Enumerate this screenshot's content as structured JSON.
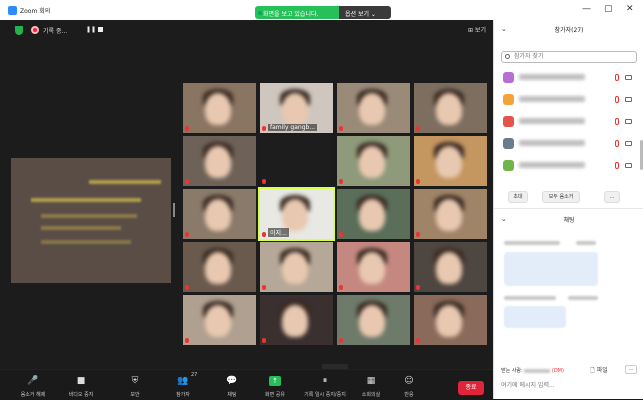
{
  "window": {
    "title": "Zoom 회의",
    "share_status": "화면을 보고 있습니다.",
    "view_options": "옵션 보기 ⌄",
    "controls": [
      "—",
      "▢",
      "✕"
    ]
  },
  "meeting": {
    "recording_label": "기록 중...",
    "view_label": "⊞ 보기"
  },
  "tiles": [
    {
      "name": "",
      "bg": "#8a7462"
    },
    {
      "name": "family gangb...",
      "bg": "#cfc7bf"
    },
    {
      "name": "",
      "bg": "#9a8a78"
    },
    {
      "name": "",
      "bg": "#7d6e60"
    },
    {
      "name": "",
      "bg": "#6e6258"
    },
    {
      "name": "",
      "bg": "#1d1d1d"
    },
    {
      "name": "",
      "bg": "#8e9a7a"
    },
    {
      "name": "",
      "bg": "#c49660"
    },
    {
      "name": "",
      "bg": "#8a7a6a"
    },
    {
      "name": "이지...",
      "bg": "#e8e8e4"
    },
    {
      "name": "",
      "bg": "#5a6e5a"
    },
    {
      "name": "",
      "bg": "#a08468"
    },
    {
      "name": "",
      "bg": "#6a5a4e"
    },
    {
      "name": "",
      "bg": "#b6a898"
    },
    {
      "name": "",
      "bg": "#c48880"
    },
    {
      "name": "",
      "bg": "#4e4640"
    },
    {
      "name": "",
      "bg": "#b0a090"
    },
    {
      "name": "",
      "bg": "#3a3030"
    },
    {
      "name": "",
      "bg": "#6e7a6a"
    },
    {
      "name": "",
      "bg": "#8a6a5a"
    }
  ],
  "toolbar": {
    "items": [
      {
        "icon": "🎤",
        "label": "음소거 해제"
      },
      {
        "icon": "■",
        "label": "비디오 중지"
      },
      {
        "icon": "⛨",
        "label": "보안"
      },
      {
        "icon": "👥",
        "label": "참가자",
        "count": "27"
      },
      {
        "icon": "💬",
        "label": "채팅"
      },
      {
        "icon": "↑",
        "label": "화면 공유"
      },
      {
        "icon": "⏸",
        "label": "기록 일시 중지/중지"
      },
      {
        "icon": "▦",
        "label": "소회의실"
      },
      {
        "icon": "☺",
        "label": "반응"
      }
    ],
    "end_label": "종료"
  },
  "panel": {
    "participants_title": "참가자(27)",
    "search_placeholder": "참가자 찾기",
    "participant_colors": [
      "#b56fd6",
      "#f2a33a",
      "#e5544a",
      "#6b7a8c",
      "#6fb54a"
    ],
    "invite_label": "초대",
    "mute_all_label": "모두 음소거",
    "more_label": "...",
    "chat_title": "채팅",
    "chat_to_label": "받는 사람:",
    "chat_dm": "(DM)",
    "file_label": "🗋 파일",
    "chat_more": "...",
    "chat_placeholder": "여기에 메시지 입력..."
  }
}
